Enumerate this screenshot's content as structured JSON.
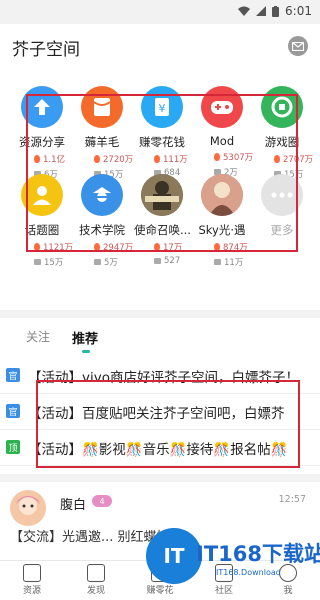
{
  "status_bar": {
    "time": "6:01"
  },
  "header": {
    "title": "芥子空间"
  },
  "grid": [
    {
      "name": "资源分享",
      "v1": "1.1亿",
      "v2": "6万",
      "color": "#3a9bf2",
      "icon": "upload-icon"
    },
    {
      "name": "薅羊毛",
      "v1": "2720万",
      "v2": "15万",
      "color": "#f46a2a",
      "icon": "red-packet-icon"
    },
    {
      "name": "赚零花钱",
      "v1": "111万",
      "v2": "684",
      "color": "#29a8f3",
      "icon": "yen-card-icon"
    },
    {
      "name": "Mod",
      "v1": "5307万",
      "v2": "2万",
      "color": "#f0474b",
      "icon": "gamepad-icon"
    },
    {
      "name": "游戏圈",
      "v1": "2707万",
      "v2": "15万",
      "color": "#34b45b",
      "icon": "game-circle-icon"
    },
    {
      "name": "话题圈",
      "v1": "1121万",
      "v2": "15万",
      "color": "#f5c410",
      "icon": "user-topic-icon"
    },
    {
      "name": "技术学院",
      "v1": "2947万",
      "v2": "5万",
      "color": "#3a91e8",
      "icon": "detective-icon"
    },
    {
      "name": "使命召唤...",
      "v1": "17万",
      "v2": "527",
      "color": "#6b5f47",
      "icon": "call-of-duty-icon"
    },
    {
      "name": "Sky光·遇",
      "v1": "874万",
      "v2": "11万",
      "color": "#c48a7a",
      "icon": "sky-game-icon"
    },
    {
      "name": "更多",
      "v1": "",
      "v2": "",
      "color": "#e3e3e3",
      "icon": "more-icon"
    }
  ],
  "tabs": {
    "follow": "关注",
    "recommend": "推荐"
  },
  "posts": [
    {
      "badge": "官",
      "badge_color": "#3a8ee6",
      "text": "【活动】vivo商店好评芥子空间，白嫖芥子！"
    },
    {
      "badge": "官",
      "badge_color": "#3a8ee6",
      "text": "【活动】百度贴吧关注芥子空间吧，白嫖芥"
    },
    {
      "badge": "顶",
      "badge_color": "#2ab34f",
      "text": "【活动】🎊影视🎊音乐🎊接待🎊报名帖🎊"
    }
  ],
  "user_post": {
    "username": "腹白",
    "level": "4",
    "time": "12:57",
    "preview": "【交流】光遇邀... 别红蝶她"
  },
  "bottom_nav": [
    "资源",
    "发现",
    "赚零花",
    "社区",
    "我"
  ],
  "watermark": {
    "logo": "IT",
    "text": "IT168下载站",
    "sub": "IT168.Download"
  }
}
